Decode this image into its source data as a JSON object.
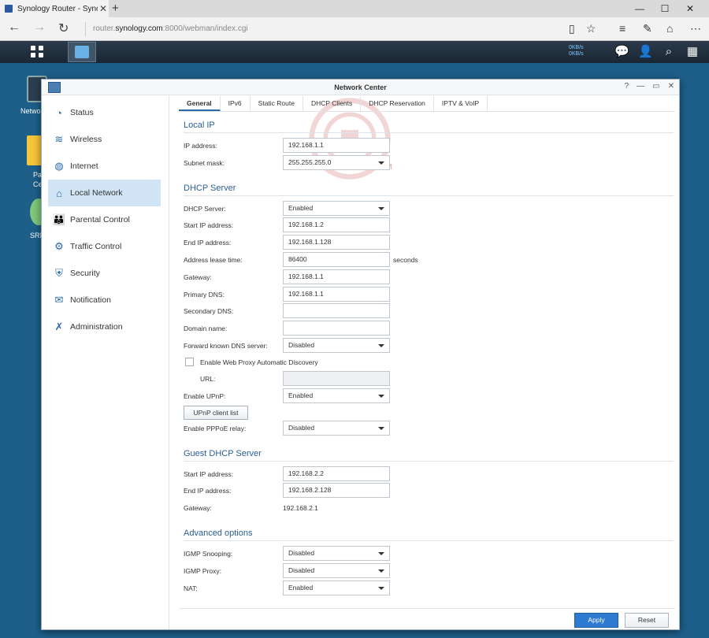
{
  "browser": {
    "tab_title": "Synology Router - Syno",
    "url_prefix": "router.",
    "url_domain": "synology.com",
    "url_suffix": ":8000/webman/index.cgi"
  },
  "taskbar": {
    "upload_speed": "0KB/s",
    "download_speed": "0KB/s"
  },
  "desktop": {
    "icon1_label": "Netwo",
    "icon2_label_line1": "Pa",
    "icon2_label_line2": "Ce",
    "icon3_label": "SRI"
  },
  "window": {
    "title": "Network Center",
    "watermark": "VMODTECH.COM"
  },
  "sidebar": {
    "items": [
      {
        "label": "Status",
        "icon": "gauge-icon"
      },
      {
        "label": "Wireless",
        "icon": "wifi-icon"
      },
      {
        "label": "Internet",
        "icon": "globe-icon"
      },
      {
        "label": "Local Network",
        "icon": "home-icon",
        "active": true
      },
      {
        "label": "Parental Control",
        "icon": "family-icon"
      },
      {
        "label": "Traffic Control",
        "icon": "sliders-icon"
      },
      {
        "label": "Security",
        "icon": "shield-icon"
      },
      {
        "label": "Notification",
        "icon": "envelope-icon"
      },
      {
        "label": "Administration",
        "icon": "tools-icon"
      }
    ]
  },
  "tabs": [
    "General",
    "IPv6",
    "Static Route",
    "DHCP Clients",
    "DHCP Reservation",
    "IPTV & VoIP"
  ],
  "local_ip": {
    "title": "Local IP",
    "ip_label": "IP address:",
    "ip_value": "192.168.1.1",
    "mask_label": "Subnet mask:",
    "mask_value": "255.255.255.0"
  },
  "dhcp": {
    "title": "DHCP Server",
    "server_label": "DHCP Server:",
    "server_value": "Enabled",
    "start_label": "Start IP address:",
    "start_value": "192.168.1.2",
    "end_label": "End IP address:",
    "end_value": "192.168.1.128",
    "lease_label": "Address lease time:",
    "lease_value": "86400",
    "lease_suffix": "seconds",
    "gateway_label": "Gateway:",
    "gateway_value": "192.168.1.1",
    "pdns_label": "Primary DNS:",
    "pdns_value": "192.168.1.1",
    "sdns_label": "Secondary DNS:",
    "sdns_value": "",
    "domain_label": "Domain name:",
    "domain_value": "",
    "fwd_label": "Forward known DNS server:",
    "fwd_value": "Disabled",
    "wpad_label": "Enable Web Proxy Automatic Discovery",
    "url_label": "URL:",
    "url_value": "",
    "upnp_label": "Enable UPnP:",
    "upnp_value": "Enabled",
    "upnp_btn": "UPnP client list",
    "pppoe_label": "Enable PPPoE relay:",
    "pppoe_value": "Disabled"
  },
  "guest": {
    "title": "Guest DHCP Server",
    "start_label": "Start IP address:",
    "start_value": "192.168.2.2",
    "end_label": "End IP address:",
    "end_value": "192.168.2.128",
    "gateway_label": "Gateway:",
    "gateway_value": "192.168.2.1"
  },
  "advanced": {
    "title": "Advanced options",
    "igmp_snoop_label": "IGMP Snooping:",
    "igmp_snoop_value": "Disabled",
    "igmp_proxy_label": "IGMP Proxy:",
    "igmp_proxy_value": "Disabled",
    "nat_label": "NAT:",
    "nat_value": "Enabled"
  },
  "footer": {
    "apply": "Apply",
    "reset": "Reset"
  }
}
